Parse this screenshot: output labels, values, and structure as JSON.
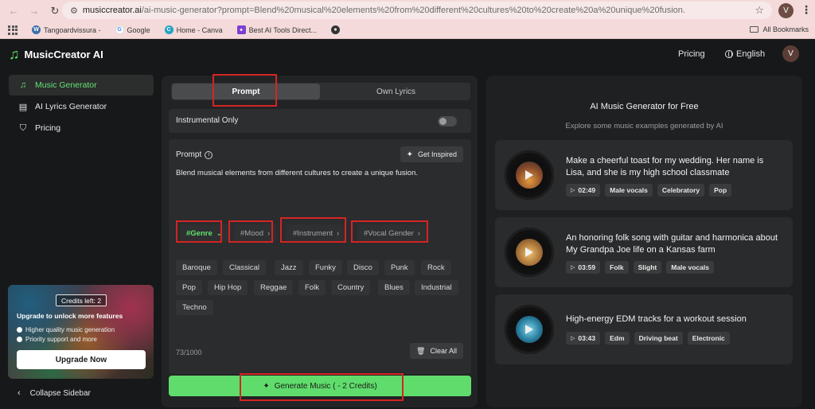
{
  "browser": {
    "url_host": "musiccreator.ai",
    "url_path": "/ai-music-generator?prompt=Blend%20musical%20elements%20from%20different%20cultures%20to%20create%20a%20unique%20fusion.",
    "profile_initial": "V",
    "bookmarks": [
      "Tangoardvissura -",
      "Google",
      "Home - Canva",
      "Best AI Tools Direct..."
    ],
    "all_bookmarks": "All Bookmarks"
  },
  "header": {
    "app_name": "MusicCreator AI",
    "pricing": "Pricing",
    "language": "English",
    "avatar_initial": "V"
  },
  "sidebar": {
    "items": [
      {
        "label": "Music Generator",
        "icon": "music-note-icon",
        "active": true
      },
      {
        "label": "AI Lyrics Generator",
        "icon": "document-icon",
        "active": false
      },
      {
        "label": "Pricing",
        "icon": "tag-icon",
        "active": false
      }
    ],
    "promo": {
      "credits": "Credits left: 2",
      "title": "Upgrade to unlock more features",
      "features": [
        "Higher quality music generation",
        "Priority support and more"
      ],
      "button": "Upgrade Now"
    },
    "collapse": "Collapse Sidebar"
  },
  "main": {
    "tabs": [
      "Prompt",
      "Own Lyrics"
    ],
    "instrumental_label": "Instrumental Only",
    "instrumental_on": false,
    "prompt_label": "Prompt",
    "get_inspired": "Get Inspired",
    "prompt_text": "Blend musical elements from different cultures to create a unique fusion.",
    "filters": [
      "#Genre",
      "#Mood",
      "#Instrument",
      "#Vocal Gender"
    ],
    "genre_row1": [
      "Baroque",
      "Classical",
      "Jazz",
      "Funky",
      "Disco",
      "Punk",
      "Rock"
    ],
    "genre_row2": [
      "Pop",
      "Hip Hop",
      "Reggae",
      "Folk",
      "Country",
      "Blues",
      "Industrial"
    ],
    "genre_row3": [
      "Techno"
    ],
    "char_count": "73/1000",
    "clear_all": "Clear All",
    "generate": "Generate Music ( - 2 Credits)"
  },
  "examples": {
    "title": "AI Music Generator for Free",
    "subtitle": "Explore some music examples generated by AI",
    "cards": [
      {
        "title": "Make a cheerful toast for my wedding. Her name is Lisa, and she is my high school classmate",
        "duration": "02:49",
        "tags": [
          "Male vocals",
          "Celebratory",
          "Pop"
        ]
      },
      {
        "title": "An honoring folk song with guitar and harmonica about My Grandpa Joe life on a Kansas farm",
        "duration": "03:59",
        "tags": [
          "Folk",
          "Slight",
          "Male vocals"
        ]
      },
      {
        "title": "High-energy EDM tracks for a workout session",
        "duration": "03:43",
        "tags": [
          "Edm",
          "Driving beat",
          "Electronic"
        ]
      }
    ]
  },
  "colors": {
    "accent": "#5fdc6b",
    "annotation": "#d42424"
  }
}
